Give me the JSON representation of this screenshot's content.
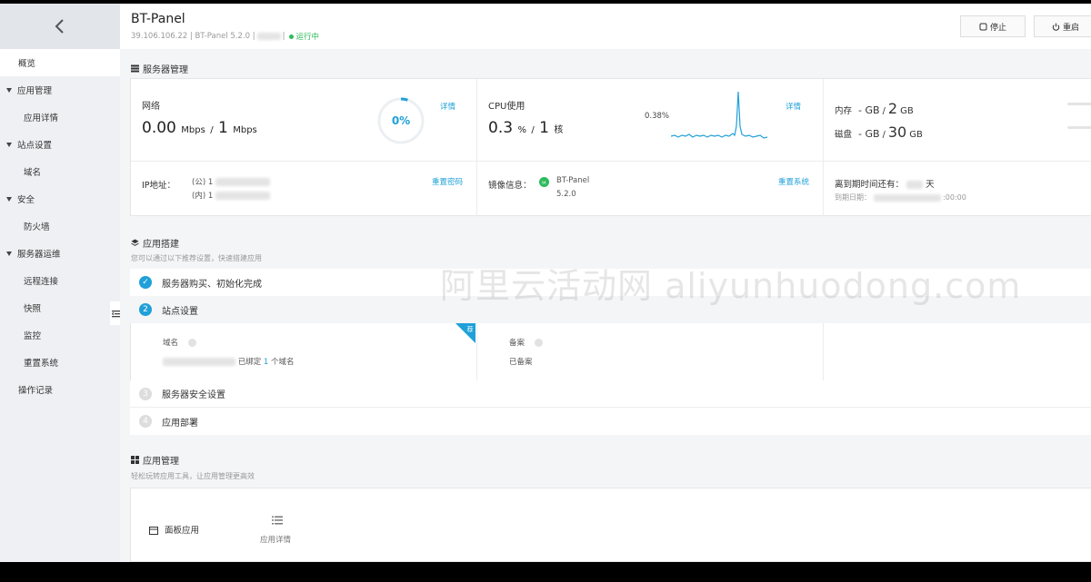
{
  "header": {
    "title": "BT-Panel",
    "ip": "39.106.106.22",
    "sep1": "|",
    "product": "BT-Panel 5.2.0",
    "sep2": "|",
    "sep3": "|",
    "status": "运行中",
    "stop_label": "停止",
    "restart_label": "重启"
  },
  "sidebar": {
    "items": [
      {
        "label": "概览"
      },
      {
        "label": "应用管理"
      },
      {
        "label": "应用详情"
      },
      {
        "label": "站点设置"
      },
      {
        "label": "域名"
      },
      {
        "label": "安全"
      },
      {
        "label": "防火墙"
      },
      {
        "label": "服务器运维"
      },
      {
        "label": "远程连接"
      },
      {
        "label": "快照"
      },
      {
        "label": "监控"
      },
      {
        "label": "重置系统"
      },
      {
        "label": "操作记录"
      }
    ]
  },
  "server": {
    "section_title": "服务器管理",
    "network": {
      "label": "网络",
      "value1": "0.00",
      "unit1": "Mbps",
      "slash": "/",
      "value2": "1",
      "unit2": "Mbps",
      "percent_text": "0%",
      "percent": 0.05,
      "detail_link": "详情"
    },
    "cpu": {
      "label": "CPU使用",
      "value": "0.3",
      "unit": "%",
      "slash": "/",
      "cores": "1",
      "cores_unit": "核",
      "peak_label": "0.38%",
      "detail_link": "详情"
    },
    "memory": {
      "label": "内存",
      "used": "- GB",
      "slash": "/",
      "total": "2",
      "unit": "GB"
    },
    "disk": {
      "label": "磁盘",
      "used": "- GB",
      "slash": "/",
      "total": "30",
      "unit": "GB"
    },
    "ip": {
      "label": "IP地址：",
      "public_prefix": "(公) 1",
      "private_prefix": "(内) 1",
      "reset_password": "重置密码"
    },
    "image": {
      "label": "镜像信息：",
      "name": "BT-Panel",
      "version": "5.2.0",
      "reset_system": "重置系统"
    },
    "expiry": {
      "label": "离到期时间还有：",
      "unit": "天",
      "date_label": "到期日期：",
      "date_suffix": ":00:00"
    }
  },
  "setup": {
    "section_title": "应用搭建",
    "subtitle": "您可以通过以下推荐设置，快速搭建应用",
    "steps": [
      {
        "num": "✓",
        "label": "服务器购买、初始化完成"
      },
      {
        "num": "2",
        "label": "站点设置"
      },
      {
        "num": "3",
        "label": "服务器安全设置"
      },
      {
        "num": "4",
        "label": "应用部署"
      }
    ],
    "domain_label": "域名",
    "domain_bound_prefix": "已绑定",
    "domain_count": "1",
    "domain_bound_suffix": "个域名",
    "recommend_badge": "荐",
    "beian_label": "备案",
    "beian_status": "已备案"
  },
  "apps": {
    "section_title": "应用管理",
    "subtitle": "轻松玩转应用工具，让应用管理更高效",
    "panel_app": "面板应用",
    "app_detail": "应用详情"
  },
  "watermark": "阿里云活动网 aliyunhuodong.com",
  "colors": {
    "accent": "#20a0d8",
    "running": "#2dbb5c"
  }
}
